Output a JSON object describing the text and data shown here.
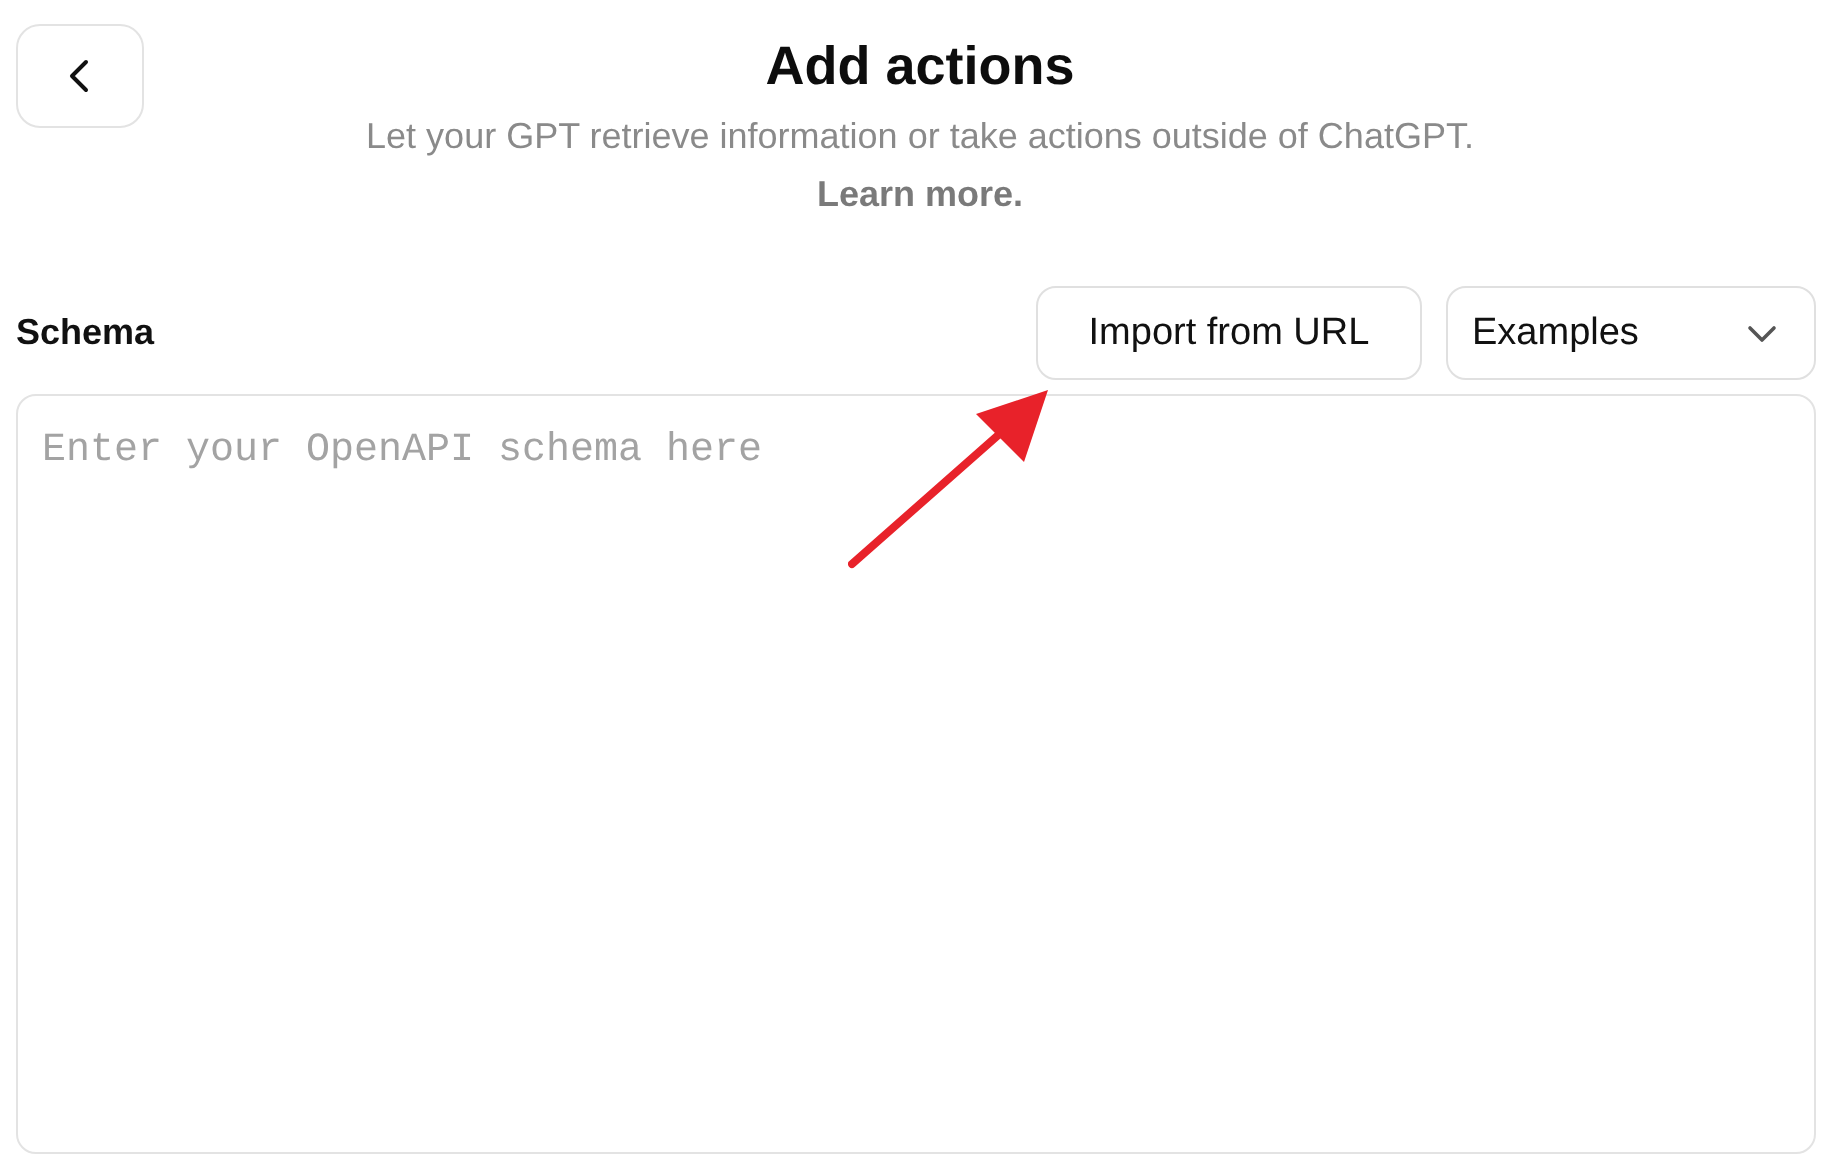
{
  "header": {
    "title": "Add actions",
    "subtitle": "Let your GPT retrieve information or take actions outside of ChatGPT.",
    "learn_more_link": "Learn more."
  },
  "schema": {
    "label": "Schema",
    "import_button": "Import from URL",
    "examples_dropdown": {
      "value": "Examples"
    },
    "editor": {
      "placeholder": "Enter your OpenAPI schema here"
    }
  }
}
